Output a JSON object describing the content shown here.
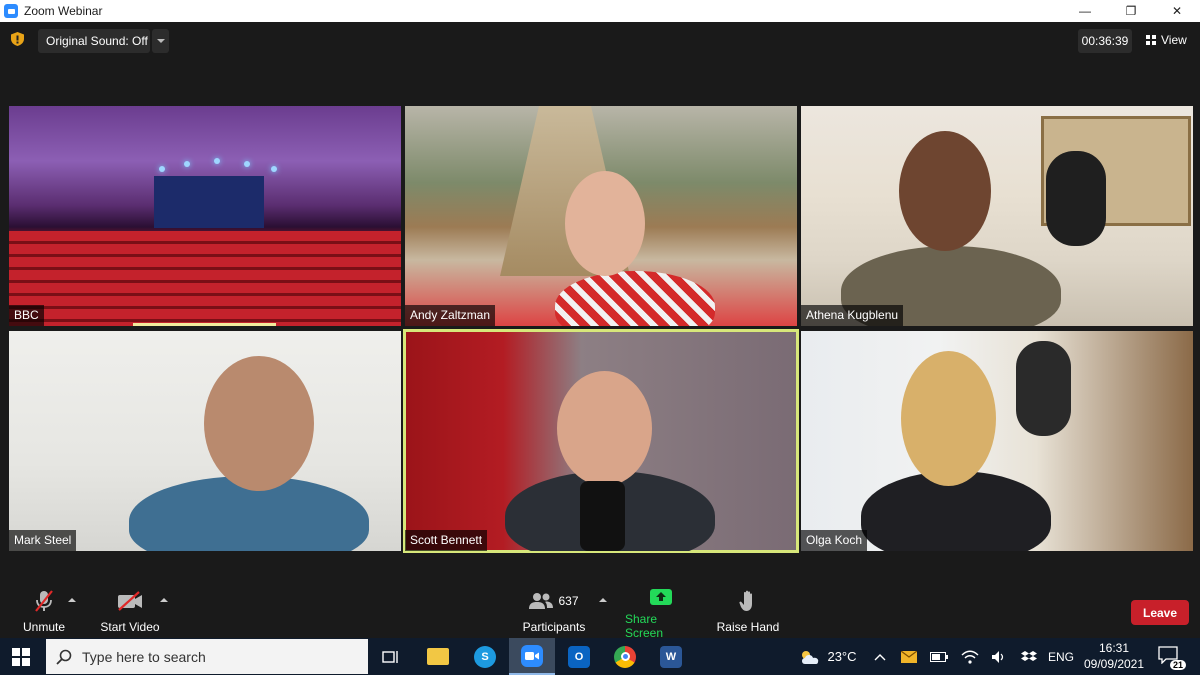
{
  "window": {
    "title": "Zoom Webinar",
    "controls": {
      "minimize": "—",
      "restore": "❐",
      "close": "✕"
    }
  },
  "topbar": {
    "original_sound": "Original Sound: Off",
    "timer": "00:36:39",
    "view_label": "View"
  },
  "tiles": [
    {
      "name": "BBC"
    },
    {
      "name": "Andy Zaltzman"
    },
    {
      "name": "Athena Kugblenu"
    },
    {
      "name": "Mark Steel"
    },
    {
      "name": "Scott Bennett"
    },
    {
      "name": "Olga Koch"
    }
  ],
  "toolbar": {
    "unmute": "Unmute",
    "start_video": "Start Video",
    "participants_count": "637",
    "participants": "Participants",
    "share_screen": "Share Screen",
    "raise_hand": "Raise Hand",
    "leave": "Leave",
    "colors": {
      "share_green": "#23d959",
      "leave_red": "#c8202a",
      "mute_red": "#e02828"
    }
  },
  "taskbar": {
    "search_placeholder": "Type here to search",
    "weather": "23°C",
    "language": "ENG",
    "time": "16:31",
    "date": "09/09/2021",
    "notifications": "21"
  }
}
